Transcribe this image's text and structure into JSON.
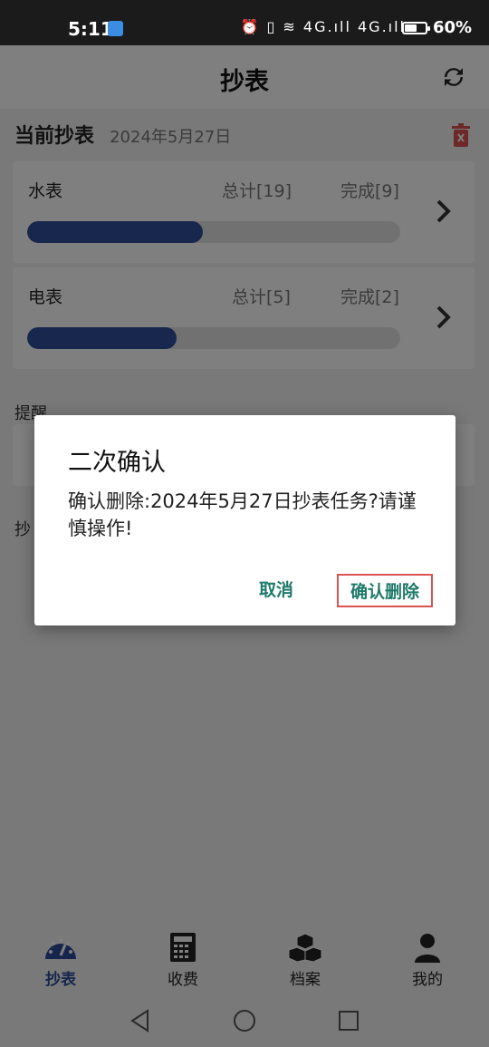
{
  "status_bar": {
    "time": "5:11",
    "signal_text": "⏰ ▯ ≋ 4G.ıll 4G.ıll",
    "battery_percent": "60%",
    "battery_level": 0.6
  },
  "header": {
    "title": "抄表"
  },
  "current": {
    "title": "当前抄表",
    "date": "2024年5月27日"
  },
  "meters": [
    {
      "name": "水表",
      "total": "总计[19]",
      "done": "完成[9]",
      "progress": 0.47
    },
    {
      "name": "电表",
      "total": "总计[5]",
      "done": "完成[2]",
      "progress": 0.4
    }
  ],
  "reminder": {
    "label": "提醒"
  },
  "second_section": {
    "label": "抄"
  },
  "dialog": {
    "title": "二次确认",
    "message": "确认删除:2024年5月27日抄表任务?请谨慎操作!",
    "cancel": "取消",
    "confirm": "确认删除"
  },
  "bottom_nav": [
    {
      "label": "抄表",
      "icon": "gauge-icon",
      "active": true
    },
    {
      "label": "收费",
      "icon": "calculator-icon",
      "active": false
    },
    {
      "label": "档案",
      "icon": "boxes-icon",
      "active": false
    },
    {
      "label": "我的",
      "icon": "person-icon",
      "active": false
    }
  ],
  "colors": {
    "accent": "#2f4f9a",
    "dialog_button": "#1f7a6a",
    "confirm_border": "#d9534f",
    "trash": "#d9534f"
  }
}
